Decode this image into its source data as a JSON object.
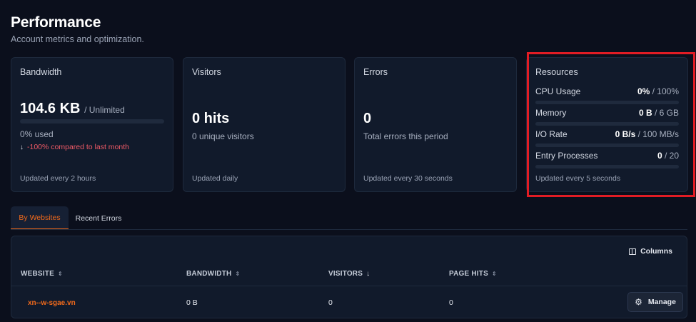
{
  "header": {
    "title": "Performance",
    "subtitle": "Account metrics and optimization."
  },
  "bandwidth": {
    "title": "Bandwidth",
    "value": "104.6 KB",
    "suffix": "/ Unlimited",
    "used_text": "0% used",
    "used_fraction": 0,
    "trend_icon": "arrow-down-icon",
    "trend_text": "-100% compared to last month",
    "footer": "Updated every 2 hours"
  },
  "visitors": {
    "title": "Visitors",
    "value": "0 hits",
    "sub": "0 unique visitors",
    "footer": "Updated daily"
  },
  "errors": {
    "title": "Errors",
    "value": "0",
    "sub": "Total errors this period",
    "footer": "Updated every 30 seconds"
  },
  "resources": {
    "title": "Resources",
    "rows": [
      {
        "label": "CPU Usage",
        "value": "0%",
        "limit": "/ 100%",
        "fraction": 0
      },
      {
        "label": "Memory",
        "value": "0 B",
        "limit": "/ 6 GB",
        "fraction": 0
      },
      {
        "label": "I/O Rate",
        "value": "0 B/s",
        "limit": "/ 100 MB/s",
        "fraction": 0
      },
      {
        "label": "Entry Processes",
        "value": "0",
        "limit": "/ 20",
        "fraction": 0
      }
    ],
    "footer": "Updated every 5 seconds"
  },
  "tabs": [
    {
      "label": "By Websites",
      "active": true
    },
    {
      "label": "Recent Errors",
      "active": false
    }
  ],
  "table": {
    "columns_button": "Columns",
    "headers": [
      "WEBSITE",
      "BANDWIDTH",
      "VISITORS",
      "PAGE HITS"
    ],
    "rows": [
      {
        "website": "xn--w-sgae.vn",
        "bandwidth": "0 B",
        "visitors": "0",
        "page_hits": "0",
        "action": "Manage"
      }
    ]
  },
  "colors": {
    "accent": "#f26a1b",
    "highlight": "#e21c24",
    "negative": "#ef5a66"
  }
}
